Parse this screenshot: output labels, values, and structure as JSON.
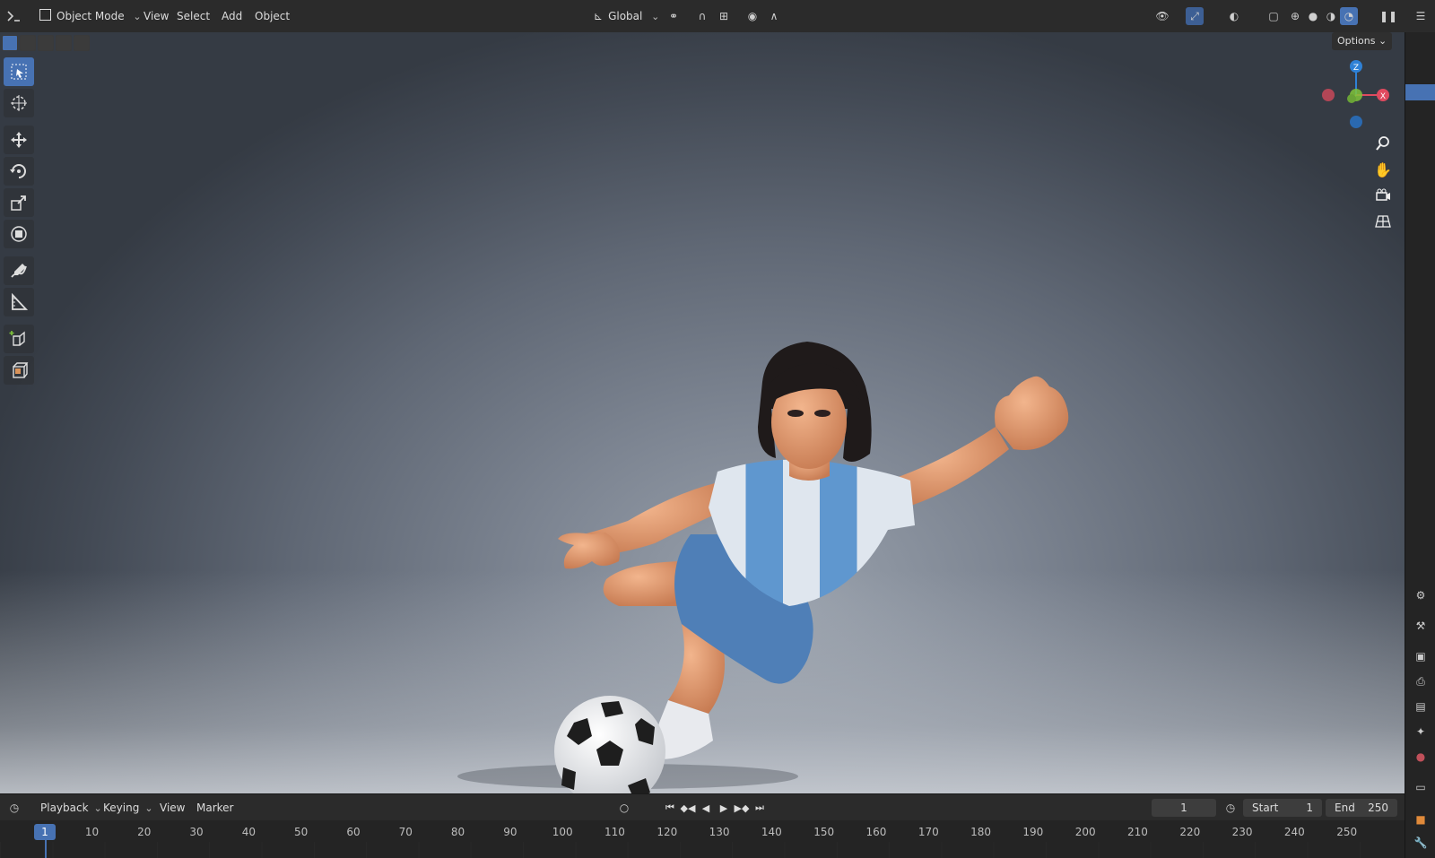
{
  "header": {
    "mode_label": "Object Mode",
    "menu": [
      "View",
      "Select",
      "Add",
      "Object"
    ],
    "orientation_label": "Global"
  },
  "viewport": {
    "options_label": "Options",
    "gizmo": {
      "z": "Z",
      "x": "X"
    },
    "tools": [
      "select-box",
      "cursor",
      "move",
      "rotate",
      "scale",
      "transform",
      "annotate",
      "measure",
      "add-cube",
      "add-object"
    ]
  },
  "timeline": {
    "menu": [
      "Playback",
      "Keying",
      "View",
      "Marker"
    ],
    "current_frame": "1",
    "start_label": "Start",
    "start_value": "1",
    "end_label": "End",
    "end_value": "250",
    "ticks": [
      "10",
      "20",
      "30",
      "40",
      "50",
      "60",
      "70",
      "80",
      "90",
      "100",
      "110",
      "120",
      "130",
      "140",
      "150",
      "160",
      "170",
      "180",
      "190",
      "200",
      "210",
      "220",
      "230",
      "240",
      "250"
    ]
  },
  "colors": {
    "accent": "#4772b3",
    "axis_x": "#e04a5f",
    "axis_y": "#7fc43a",
    "axis_z": "#2f81d6"
  }
}
